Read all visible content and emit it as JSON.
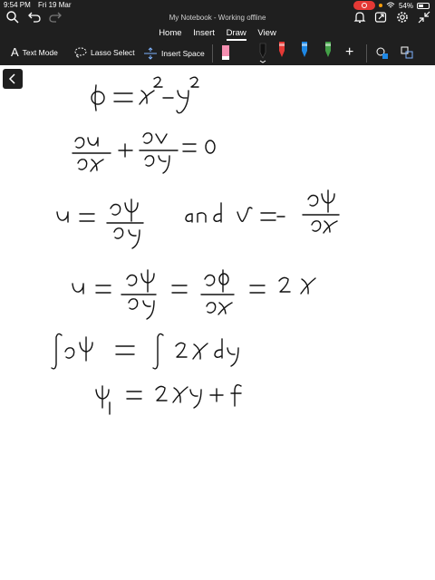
{
  "status_bar": {
    "time": "9:54 PM",
    "date": "Fri 19 Mar",
    "battery": "54%",
    "battery_level": 0.54
  },
  "window": {
    "title": "My Notebook - Working offline"
  },
  "ribbon": {
    "tabs": [
      {
        "label": "Home"
      },
      {
        "label": "Insert"
      },
      {
        "label": "Draw",
        "active": true
      },
      {
        "label": "View"
      }
    ]
  },
  "toolbar": {
    "text_mode": "Text Mode",
    "lasso_select": "Lasso Select",
    "insert_space": "Insert Space"
  },
  "pens": [
    {
      "name": "pink-highlighter",
      "color": "#f48fb1"
    },
    {
      "name": "black-pen",
      "color": "#111111",
      "selected": true
    },
    {
      "name": "red-pen",
      "color": "#e53935"
    },
    {
      "name": "blue-pen",
      "color": "#1e88e5"
    },
    {
      "name": "green-pen",
      "color": "#43a047"
    }
  ],
  "colors": {
    "chrome": "#1f1f1f",
    "ink": "#111111",
    "page": "#ffffff"
  }
}
